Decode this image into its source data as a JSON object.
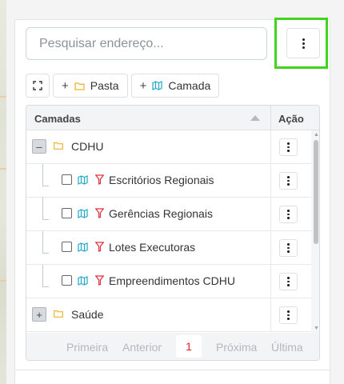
{
  "search": {
    "placeholder": "Pesquisar endereço..."
  },
  "toolbar": {
    "folder_label": "Pasta",
    "layer_label": "Camada"
  },
  "table": {
    "col_layers": "Camadas",
    "col_action": "Ação",
    "rows": [
      {
        "label": "CDHU",
        "type": "folder",
        "expander": "–"
      },
      {
        "label": "Escritórios Regionais",
        "type": "layer"
      },
      {
        "label": "Gerências Regionais",
        "type": "layer"
      },
      {
        "label": "Lotes Executoras",
        "type": "layer"
      },
      {
        "label": "Empreendimentos CDHU",
        "type": "layer"
      },
      {
        "label": "Saúde",
        "type": "folder",
        "expander": "+"
      }
    ]
  },
  "pagination": {
    "first": "Primeira",
    "previous": "Anterior",
    "current": "1",
    "next": "Próxima",
    "last": "Última"
  },
  "colors": {
    "highlight": "#41d41f",
    "folder": "#f0b429",
    "map": "#1ea7c9",
    "filter": "#e0303a",
    "current_page": "#e02424"
  },
  "icons": [
    "expand-icon",
    "plus-icon",
    "folder-icon",
    "map-icon",
    "filter-icon",
    "kebab-icon"
  ]
}
